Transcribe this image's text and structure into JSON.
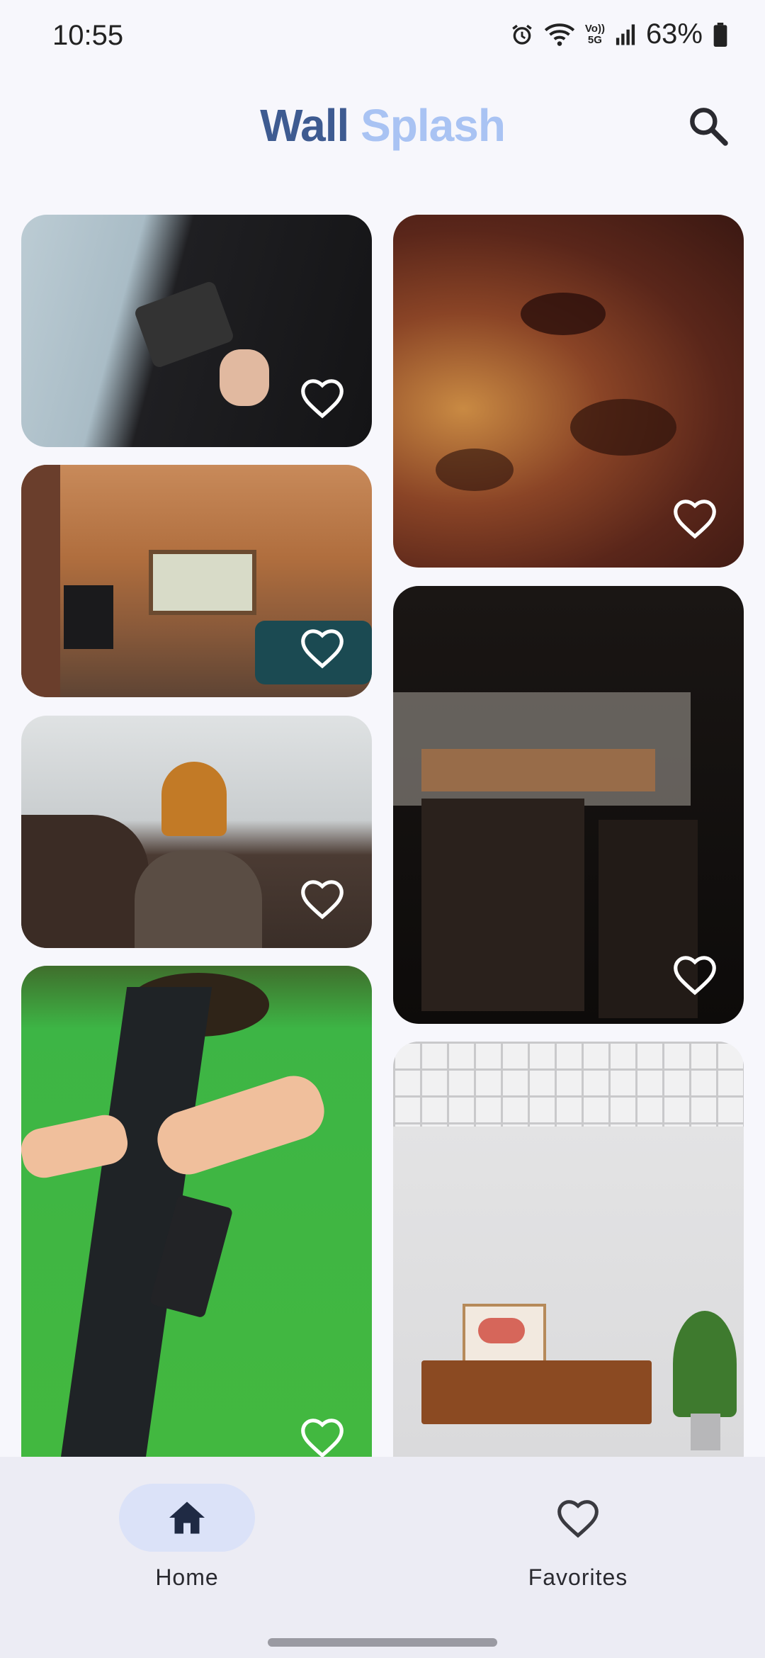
{
  "status_bar": {
    "time": "10:55",
    "network": "5G",
    "volte": "Vo)) 5G",
    "battery": "63%"
  },
  "header": {
    "title_part1": "Wall",
    "title_part2": "Splash",
    "search_icon": "search-icon"
  },
  "gallery": {
    "items": [
      {
        "description": "camera-rig photo",
        "favorite_icon": "heart-outline-icon"
      },
      {
        "description": "wooden living room",
        "favorite_icon": "heart-outline-icon"
      },
      {
        "description": "person in orange beanie at coast",
        "favorite_icon": "heart-outline-icon"
      },
      {
        "description": "person in green t-shirt with backpack",
        "favorite_icon": "heart-outline-icon"
      },
      {
        "description": "night sky nebula",
        "favorite_icon": "heart-outline-icon"
      },
      {
        "description": "dark restaurant interior",
        "favorite_icon": "heart-outline-icon"
      },
      {
        "description": "white wall with wooden sideboard and plant",
        "favorite_icon": "heart-outline-icon"
      }
    ]
  },
  "bottom_nav": {
    "items": [
      {
        "label": "Home",
        "icon": "home-icon",
        "active": true
      },
      {
        "label": "Favorites",
        "icon": "heart-outline-icon",
        "active": false
      }
    ]
  },
  "colors": {
    "title_primary": "#3e5b91",
    "title_secondary": "#a9c3f3",
    "nav_active": "#dbe2f8",
    "background": "#f7f7fc"
  }
}
